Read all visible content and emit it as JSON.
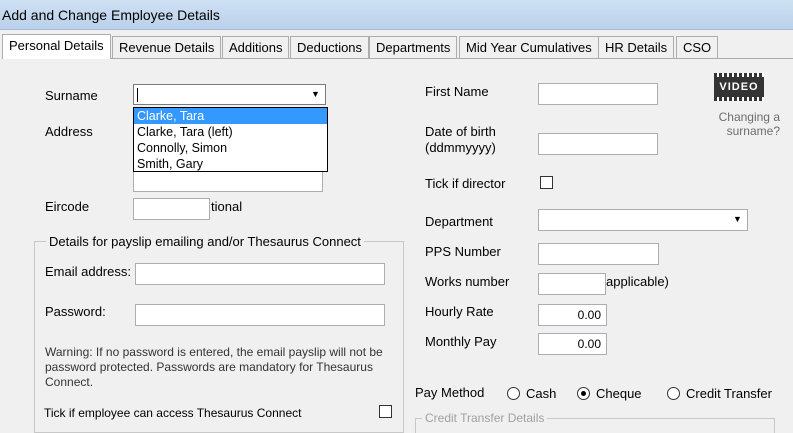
{
  "window": {
    "title": "Add and Change Employee Details"
  },
  "tabs": [
    {
      "label": "Personal Details",
      "active": true
    },
    {
      "label": "Revenue Details"
    },
    {
      "label": "Additions"
    },
    {
      "label": "Deductions"
    },
    {
      "label": "Departments"
    },
    {
      "label": "Mid Year Cumulatives"
    },
    {
      "label": "HR Details"
    },
    {
      "label": "CSO"
    }
  ],
  "left": {
    "surname_label": "Surname",
    "surname_value": "",
    "surname_options": [
      "Clarke, Tara",
      "Clarke, Tara (left)",
      "Connolly, Simon",
      "Smith, Gary"
    ],
    "surname_selected_index": 0,
    "address_label": "Address",
    "eircode_label": "Eircode",
    "eircode_suffix": "tional"
  },
  "email_group": {
    "title": "Details for payslip emailing and/or Thesaurus Connect",
    "email_label": "Email address:",
    "password_label": "Password:",
    "warning": "Warning: If no password is entered, the email payslip will not be password protected. Passwords are mandatory for Thesaurus Connect.",
    "connect_label": "Tick if employee can access Thesaurus Connect"
  },
  "right": {
    "first_name_label": "First Name",
    "dob_label_line1": "Date of birth",
    "dob_label_line2": "(ddmmyyyy)",
    "director_label": "Tick if director",
    "department_label": "Department",
    "pps_label": "PPS Number",
    "works_label": "Works number",
    "works_suffix": "applicable)",
    "hourly_label": "Hourly Rate",
    "hourly_value": "0.00",
    "monthly_label": "Monthly Pay",
    "monthly_value": "0.00"
  },
  "video": {
    "icon_text": "VIDEO",
    "help_line1": "Changing a",
    "help_line2": "surname?"
  },
  "pay_method": {
    "label": "Pay Method",
    "options": [
      "Cash",
      "Cheque",
      "Credit Transfer"
    ],
    "selected": "Cheque",
    "credit_group_title": "Credit Transfer Details"
  }
}
